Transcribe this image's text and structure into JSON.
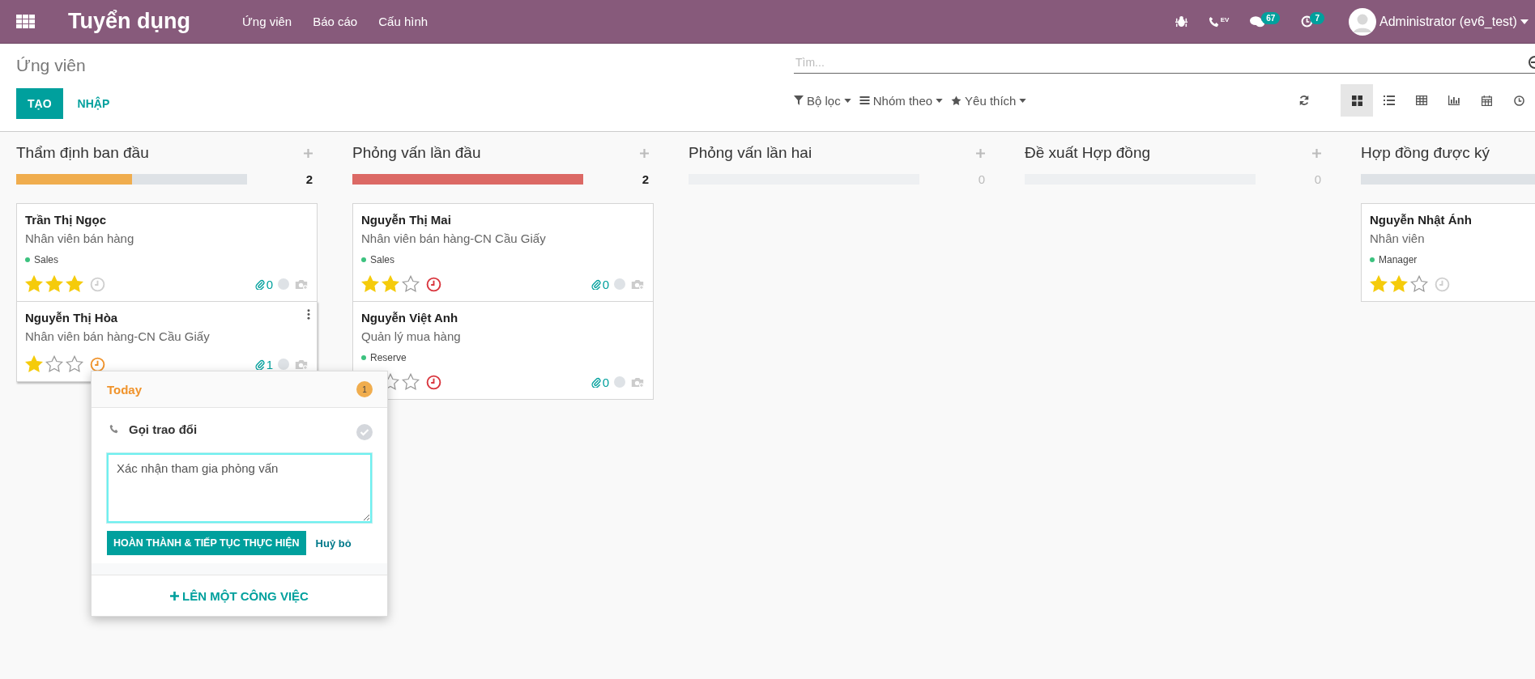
{
  "navbar": {
    "app_title": "Tuyển dụng",
    "menu": [
      {
        "label": "Ứng viên"
      },
      {
        "label": "Báo cáo"
      },
      {
        "label": "Cấu hình"
      }
    ],
    "systray": [
      {
        "kind": "debug"
      },
      {
        "kind": "voip",
        "label": "EV"
      },
      {
        "kind": "messages",
        "badge": "67"
      },
      {
        "kind": "activities",
        "badge": "7"
      }
    ],
    "user": "Administrator (ev6_test)"
  },
  "breadcrumb": "Ứng viên",
  "buttons": [
    {
      "kind": "primary",
      "label": "TẠO"
    },
    {
      "kind": "link",
      "label": "NHẬP"
    }
  ],
  "search": {
    "placeholder": "Tìm..."
  },
  "filters": [
    {
      "kind": "filter",
      "label": "Bộ lọc"
    },
    {
      "kind": "group",
      "label": "Nhóm theo"
    },
    {
      "kind": "favorite",
      "label": "Yêu thích"
    }
  ],
  "views": [
    {
      "kind": "kanban",
      "selected": true
    },
    {
      "kind": "list",
      "selected": false
    },
    {
      "kind": "pivot",
      "selected": false
    },
    {
      "kind": "graph",
      "selected": false
    },
    {
      "kind": "calendar",
      "selected": false
    },
    {
      "kind": "activity",
      "selected": false
    }
  ],
  "columns": [
    {
      "title": "Thẩm định ban đầu",
      "count": "2",
      "empty": false,
      "bar": {
        "level": 0.5,
        "color": "#f0ad4e"
      },
      "cards": [
        {
          "name": "Trần Thị Ngọc",
          "job": "Nhân viên bán hàng",
          "tag": {
            "label": "Sales",
            "color": "#3cc27f"
          },
          "stars": 3,
          "activity": {
            "color": "#cfcfcf"
          },
          "attachments": "0",
          "menu": false
        },
        {
          "name": "Nguyễn Thị Hòa",
          "job": "Nhân viên bán hàng-CN Cầu Giấy",
          "stars": 1,
          "activity": {
            "color": "#f0932b"
          },
          "attachments": "1",
          "menu": true
        }
      ]
    },
    {
      "title": "Phỏng vấn lần đầu",
      "count": "2",
      "empty": false,
      "bar": {
        "level": 1,
        "color": "#dc6965"
      },
      "cards": [
        {
          "name": "Nguyễn Thị Mai",
          "job": "Nhân viên bán hàng-CN Cầu Giấy",
          "tag": {
            "label": "Sales",
            "color": "#3cc27f"
          },
          "stars": 2,
          "activity": {
            "color": "#d9363e"
          },
          "attachments": "0",
          "menu": false
        },
        {
          "name": "Nguyễn Việt Anh",
          "job": "Quản lý mua hàng",
          "tag": {
            "label": "Reserve",
            "color": "#3cc27f"
          },
          "activity": {
            "color": "#d9363e"
          },
          "attachments": "0",
          "menu": false
        }
      ]
    },
    {
      "title": "Phỏng vấn lần hai",
      "count": "0",
      "empty": true
    },
    {
      "title": "Đề xuất Hợp đồng",
      "count": "0",
      "empty": true
    },
    {
      "title": "Hợp đồng được ký",
      "empty": false,
      "cards": [
        {
          "name": "Nguyễn Nhật Ánh",
          "job": "Nhân viên",
          "tag": {
            "label": "Manager",
            "color": "#3cc27f"
          },
          "stars": 2,
          "activity": {
            "color": "#cfcfcf"
          },
          "menu": false
        }
      ]
    }
  ],
  "popup": {
    "title": "Today",
    "badge": "1",
    "activity": "Gọi trao đổi",
    "note": "Xác nhận tham gia phỏng vấn",
    "done_button": "HOÀN THÀNH & TIẾP TỤC THỰC HIỆN",
    "cancel": "Huỷ bỏ",
    "schedule": "LÊN MỘT CÔNG VIỆC"
  }
}
